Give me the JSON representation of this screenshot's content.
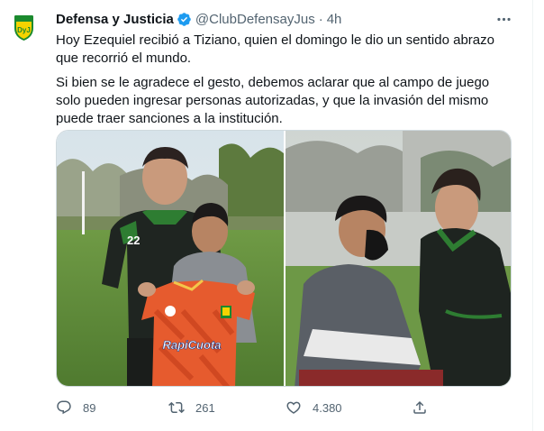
{
  "tweet": {
    "author": {
      "name": "Defensa y Justicia",
      "handle": "@ClubDefensayJus",
      "time": "4h",
      "avatar_logo_text": "DyJ",
      "verified": true
    },
    "more_icon": "more-dots-icon",
    "paragraphs": [
      "Hoy Ezequiel recibió a Tiziano, quien el domingo le dio un sentido abrazo que recorrió el mundo.",
      "Si bien se le agradece el gesto, debemos aclarar que al campo de juego solo pueden ingresar personas autorizadas, y que la invasión del mismo puede traer sanciones a la institución."
    ],
    "media": {
      "left_photo": {
        "description_icon": "photo-player-and-boy-with-shirt",
        "shirt_sponsor": "RapiCuota",
        "jersey_number": "22"
      },
      "right_photo": {
        "description_icon": "photo-player-and-boy-sitting"
      }
    },
    "actions": {
      "reply": {
        "icon": "reply-icon",
        "count": "89"
      },
      "retweet": {
        "icon": "retweet-icon",
        "count": "261"
      },
      "like": {
        "icon": "heart-icon",
        "count": "4.380"
      },
      "share": {
        "icon": "share-icon"
      }
    }
  },
  "colors": {
    "verified": "#1d9bf0",
    "muted": "#536471",
    "club_green": "#1b8a2e",
    "club_yellow": "#f5d300"
  }
}
